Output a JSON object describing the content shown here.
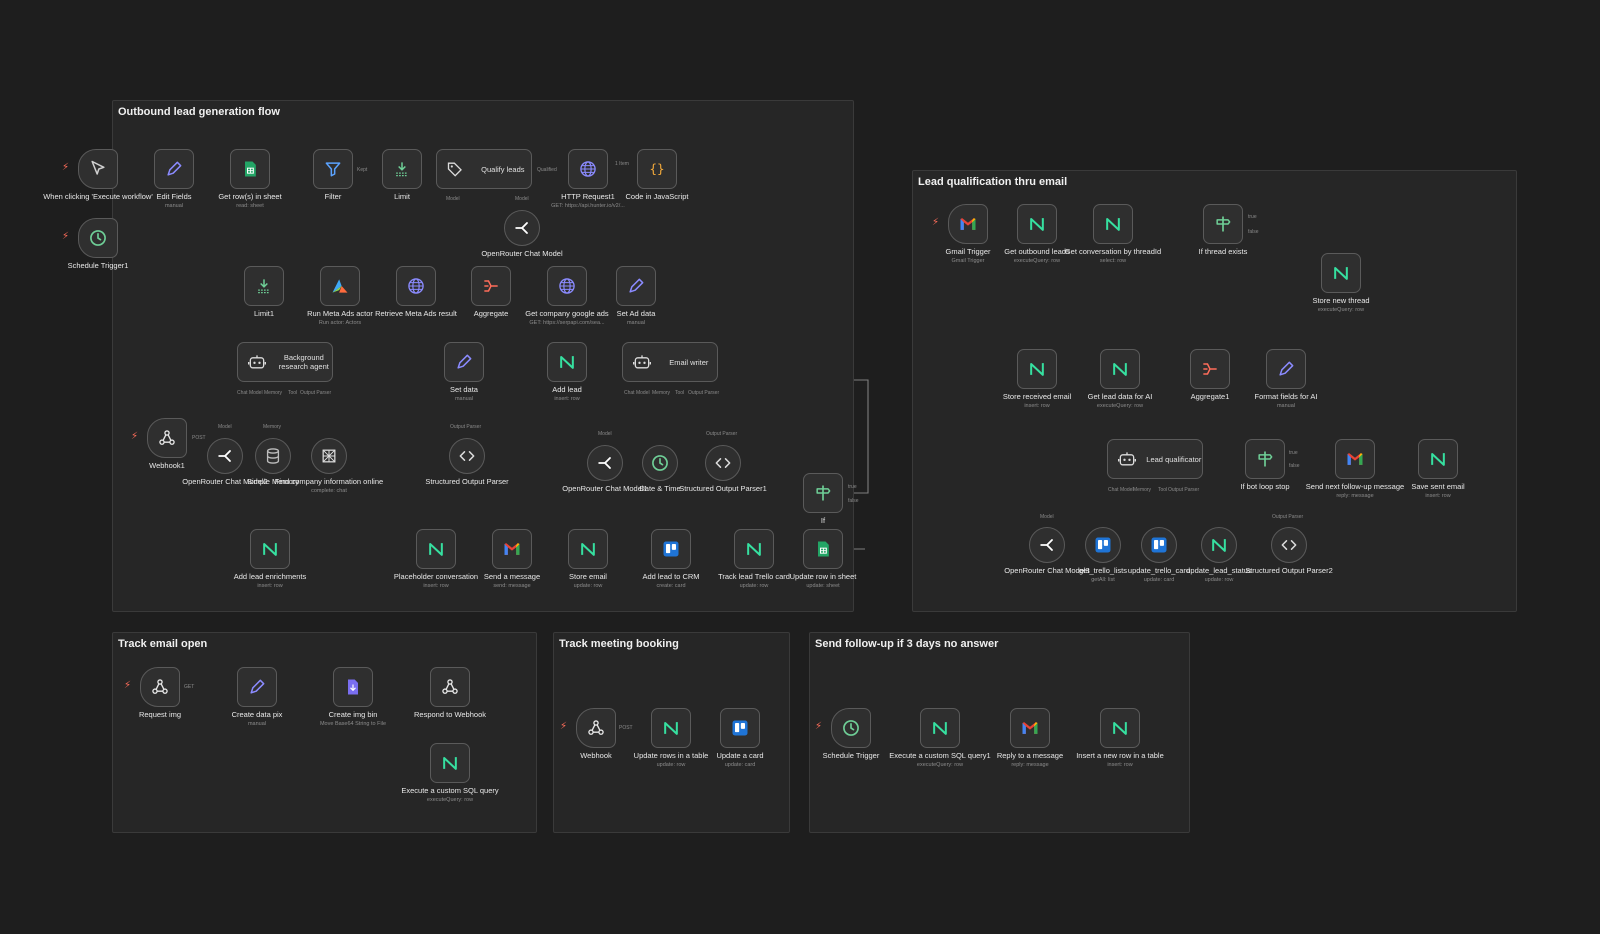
{
  "canvas": {
    "background": "#1e1e1e",
    "accent": "#ff6d5a"
  },
  "groups": [
    {
      "id": "g1",
      "title": "Outbound lead generation flow"
    },
    {
      "id": "g2",
      "title": "Lead qualification thru email"
    },
    {
      "id": "g3",
      "title": "Track email open"
    },
    {
      "id": "g4",
      "title": "Track meeting booking"
    },
    {
      "id": "g5",
      "title": "Send follow-up if 3 days no answer"
    }
  ],
  "port_labels": {
    "one_item": "1 Item",
    "model": "Model",
    "memory": "Memory",
    "tool": "Tool",
    "output_parser": "Output Parser",
    "chat_model": "Chat Model",
    "true": "true",
    "false": "false",
    "post": "POST",
    "get": "GET",
    "kept": "Kept",
    "qualified": "Qualified"
  },
  "nodes": {
    "manual_trigger": {
      "label": "When clicking 'Execute workflow'",
      "icon": "cursor-icon"
    },
    "schedule_trigger1": {
      "label": "Schedule Trigger1",
      "icon": "clock-icon"
    },
    "edit_fields": {
      "label": "Edit Fields",
      "sub": "manual",
      "icon": "pencil-icon"
    },
    "get_rows_sheet": {
      "label": "Get row(s) in sheet",
      "sub": "read: sheet",
      "icon": "sheets-icon"
    },
    "filter": {
      "label": "Filter",
      "icon": "filter-icon"
    },
    "limit": {
      "label": "Limit",
      "icon": "limit-icon"
    },
    "qualify_leads": {
      "label": "Qualify leads",
      "icon": "tags-icon"
    },
    "http_request1": {
      "label": "HTTP Request1",
      "sub": "GET: https://api.hunter.io/v2/...",
      "icon": "globe-icon"
    },
    "code_js": {
      "label": "Code in JavaScript",
      "icon": "code-braces-icon"
    },
    "openrouter_chat_model": {
      "label": "OpenRouter Chat Model",
      "icon": "openrouter-icon"
    },
    "limit1": {
      "label": "Limit1",
      "icon": "limit-icon"
    },
    "run_meta_ads": {
      "label": "Run Meta Ads actor",
      "sub": "Run actor: Actors",
      "icon": "apify-icon"
    },
    "retrieve_meta_ads": {
      "label": "Retrieve Meta Ads result",
      "icon": "globe-icon"
    },
    "aggregate": {
      "label": "Aggregate",
      "icon": "aggregate-icon"
    },
    "get_company_ads": {
      "label": "Get company google ads",
      "sub": "GET: https://serpapi.com/sea...",
      "icon": "globe-icon"
    },
    "set_ad_data": {
      "label": "Set Ad data",
      "sub": "manual",
      "icon": "pencil-icon"
    },
    "background_agent": {
      "label": "Background research agent",
      "icon": "robot-icon"
    },
    "set_data": {
      "label": "Set data",
      "sub": "manual",
      "icon": "pencil-icon"
    },
    "add_lead": {
      "label": "Add lead",
      "sub": "insert: row",
      "icon": "nocodb-icon"
    },
    "email_writer": {
      "label": "Email writer",
      "icon": "robot-icon"
    },
    "webhook1": {
      "label": "Webhook1",
      "icon": "webhook-icon"
    },
    "openrouter_chat_model2": {
      "label": "OpenRouter Chat Model2",
      "icon": "openrouter-icon"
    },
    "simple_memory": {
      "label": "Simple Memory",
      "icon": "database-icon"
    },
    "find_company_info": {
      "label": "Find company information online",
      "sub": "complete: chat",
      "icon": "perplexity-icon"
    },
    "structured_output_parser": {
      "label": "Structured Output Parser",
      "icon": "code-icon"
    },
    "openrouter_chat_model1": {
      "label": "OpenRouter Chat Model1",
      "icon": "openrouter-icon"
    },
    "date_time": {
      "label": "Date & Time",
      "icon": "clock-icon"
    },
    "structured_output_parser1": {
      "label": "Structured Output Parser1",
      "icon": "code-icon"
    },
    "if_node": {
      "label": "If",
      "icon": "signpost-icon"
    },
    "add_lead_enrichments": {
      "label": "Add lead enrichments",
      "sub": "insert: row",
      "icon": "nocodb-icon"
    },
    "placeholder_conversation": {
      "label": "Placeholder conversation",
      "sub": "insert: row",
      "icon": "nocodb-icon"
    },
    "send_message": {
      "label": "Send a message",
      "sub": "send: message",
      "icon": "gmail-icon"
    },
    "store_email": {
      "label": "Store email",
      "sub": "update: row",
      "icon": "nocodb-icon"
    },
    "add_lead_crm": {
      "label": "Add lead to CRM",
      "sub": "create: card",
      "icon": "trello-icon"
    },
    "track_lead_trello": {
      "label": "Track lead Trello card",
      "sub": "update: row",
      "icon": "nocodb-icon"
    },
    "update_row_sheet": {
      "label": "Update row in sheet",
      "sub": "update: sheet",
      "icon": "sheets-icon"
    },
    "gmail_trigger": {
      "label": "Gmail Trigger",
      "sub": "Gmail Trigger",
      "icon": "gmail-icon"
    },
    "get_outbound_leads": {
      "label": "Get outbound leads",
      "sub": "executeQuery: row",
      "icon": "nocodb-icon"
    },
    "get_conversation_thread": {
      "label": "Get conversation by threadId",
      "sub": "select: row",
      "icon": "nocodb-icon"
    },
    "if_thread_exists": {
      "label": "If thread exists",
      "icon": "signpost-icon"
    },
    "store_new_thread": {
      "label": "Store new thread",
      "sub": "executeQuery: row",
      "icon": "nocodb-icon"
    },
    "store_received_email": {
      "label": "Store received email",
      "sub": "insert: row",
      "icon": "nocodb-icon"
    },
    "get_lead_data_ai": {
      "label": "Get lead data for AI",
      "sub": "executeQuery: row",
      "icon": "nocodb-icon"
    },
    "aggregate1": {
      "label": "Aggregate1",
      "icon": "aggregate-icon"
    },
    "format_fields_ai": {
      "label": "Format fields for AI",
      "sub": "manual",
      "icon": "pencil-icon"
    },
    "lead_qualificator": {
      "label": "Lead qualificator",
      "icon": "robot-icon"
    },
    "if_bot_loop": {
      "label": "If bot loop stop",
      "icon": "signpost-icon"
    },
    "send_followup": {
      "label": "Send next follow-up message",
      "sub": "reply: message",
      "icon": "gmail-icon"
    },
    "save_sent_email": {
      "label": "Save sent email",
      "sub": "insert: row",
      "icon": "nocodb-icon"
    },
    "openrouter_chat_model3": {
      "label": "OpenRouter Chat Model3",
      "icon": "openrouter-icon"
    },
    "get_trello_lists": {
      "label": "get_trello_lists",
      "sub": "getAll: list",
      "icon": "trello-icon"
    },
    "update_trello_card": {
      "label": "update_trello_card",
      "sub": "update: card",
      "icon": "trello-icon"
    },
    "update_lead_status": {
      "label": "update_lead_status",
      "sub": "update: row",
      "icon": "nocodb-icon"
    },
    "structured_output_parser2": {
      "label": "Structured Output Parser2",
      "icon": "code-icon"
    },
    "request_img": {
      "label": "Request img",
      "icon": "webhook-icon"
    },
    "create_data_pix": {
      "label": "Create data pix",
      "sub": "manual",
      "icon": "pencil-icon"
    },
    "create_img_bin": {
      "label": "Create img bin",
      "sub": "Move Base64 String to File",
      "icon": "file-icon"
    },
    "respond_webhook": {
      "label": "Respond to Webhook",
      "icon": "webhook-icon"
    },
    "execute_sql_query": {
      "label": "Execute a custom SQL query",
      "sub": "executeQuery: row",
      "icon": "nocodb-icon"
    },
    "webhook": {
      "label": "Webhook",
      "icon": "webhook-icon"
    },
    "update_rows_table": {
      "label": "Update rows in a table",
      "sub": "update: row",
      "icon": "nocodb-icon"
    },
    "update_card": {
      "label": "Update a card",
      "sub": "update: card",
      "icon": "trello-icon"
    },
    "schedule_trigger": {
      "label": "Schedule Trigger",
      "icon": "clock-icon"
    },
    "execute_sql_query1": {
      "label": "Execute a custom SQL query1",
      "sub": "executeQuery: row",
      "icon": "nocodb-icon"
    },
    "reply_message": {
      "label": "Reply to a message",
      "sub": "reply: message",
      "icon": "gmail-icon"
    },
    "insert_new_row": {
      "label": "Insert a new row in a table",
      "sub": "insert: row",
      "icon": "nocodb-icon"
    }
  }
}
